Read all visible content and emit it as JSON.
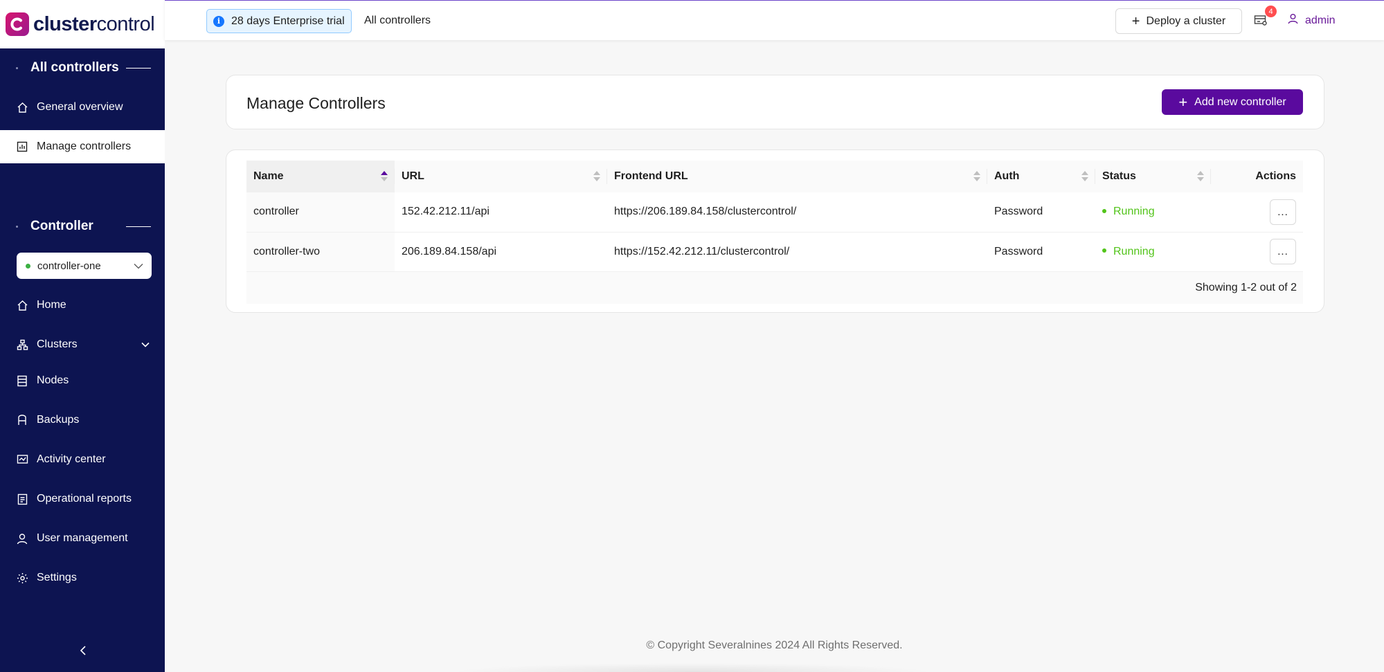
{
  "app": {
    "logo_bold": "cluster",
    "logo_regular": "control",
    "brand_color": "#5a0a9e"
  },
  "sidebar": {
    "all_controllers_title": "All controllers",
    "top_items": [
      {
        "label": "General overview",
        "icon": "home-icon"
      },
      {
        "label": "Manage controllers",
        "icon": "dashboard-icon",
        "active": true
      }
    ],
    "controller_title": "Controller",
    "controller_select": {
      "value": "controller-one",
      "status_color": "#3cb043"
    },
    "items": [
      {
        "label": "Home",
        "icon": "home-icon"
      },
      {
        "label": "Clusters",
        "icon": "cluster-icon"
      },
      {
        "label": "Nodes",
        "icon": "nodes-icon"
      },
      {
        "label": "Backups",
        "icon": "backup-icon"
      },
      {
        "label": "Activity center",
        "icon": "activity-icon"
      },
      {
        "label": "Operational reports",
        "icon": "report-icon"
      },
      {
        "label": "User management",
        "icon": "user-icon"
      },
      {
        "label": "Settings",
        "icon": "gear-icon"
      }
    ]
  },
  "topbar": {
    "trial_label": "28 days Enterprise trial",
    "breadcrumb": "All controllers",
    "deploy_label": "Deploy a cluster",
    "notification_count": "4",
    "user_name": "admin"
  },
  "main": {
    "page_title": "Manage Controllers",
    "add_button_label": "Add new controller",
    "table": {
      "columns": [
        "Name",
        "URL",
        "Frontend URL",
        "Auth",
        "Status",
        "Actions"
      ],
      "rows": [
        {
          "name": "controller",
          "url": "152.42.212.11/api",
          "frontend_url": "https://206.189.84.158/clustercontrol/",
          "auth": "Password",
          "status": "Running",
          "action": "..."
        },
        {
          "name": "controller-two",
          "url": "206.189.84.158/api",
          "frontend_url": "https://152.42.212.11/clustercontrol/",
          "auth": "Password",
          "status": "Running",
          "action": "..."
        }
      ],
      "footer": "Showing 1-2 out of 2"
    }
  },
  "footer": {
    "copyright": "© Copyright Severalnines 2024 All Rights Reserved."
  }
}
